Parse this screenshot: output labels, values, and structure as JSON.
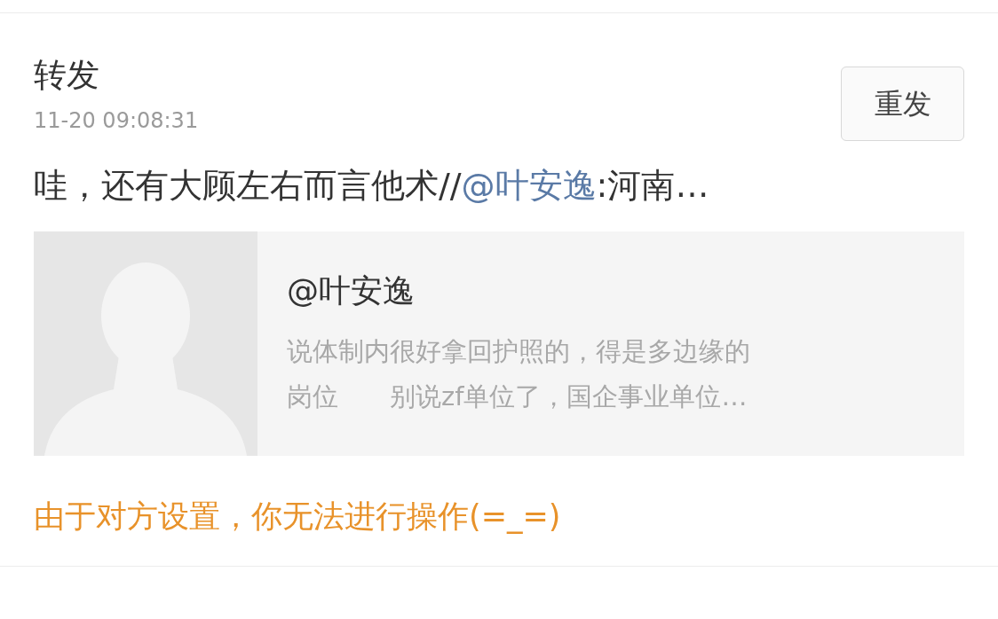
{
  "item": {
    "title": "转发",
    "time": "11-20 09:08:31",
    "button": "重发",
    "post": {
      "text": "哇，还有大顾左右而言他术//",
      "mention": "@叶安逸",
      "rest": ":河南…"
    },
    "card": {
      "name": "@叶安逸",
      "lines": [
        "说体制内很好拿回护照的，得是多边缘的",
        "岗位　　别说zf单位了，国企事业单位…"
      ]
    },
    "notice": "由于对方设置，你无法进行操作(=_=)"
  }
}
